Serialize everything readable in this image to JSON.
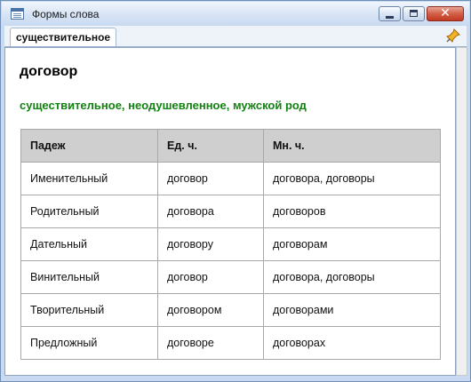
{
  "window": {
    "title": "Формы слова",
    "icon": "app-window-icon",
    "controls": [
      "minimize-icon",
      "maximize-icon",
      "close-icon"
    ]
  },
  "toolbar": {
    "tab_label": "существительное",
    "pin_icon": "pin-icon"
  },
  "entry": {
    "word": "договор",
    "grammar": "существительное, неодушевленное, мужской род",
    "grammar_color": "#128212"
  },
  "table": {
    "headers": [
      "Падеж",
      "Ед. ч.",
      "Мн. ч."
    ],
    "rows": [
      [
        "Именительный",
        "договор",
        "договора, договоры"
      ],
      [
        "Родительный",
        "договора",
        "договоров"
      ],
      [
        "Дательный",
        "договору",
        "договорам"
      ],
      [
        "Винительный",
        "договор",
        "договора, договоры"
      ],
      [
        "Творительный",
        "договором",
        "договорами"
      ],
      [
        "Предложный",
        "договоре",
        "договорах"
      ]
    ]
  }
}
